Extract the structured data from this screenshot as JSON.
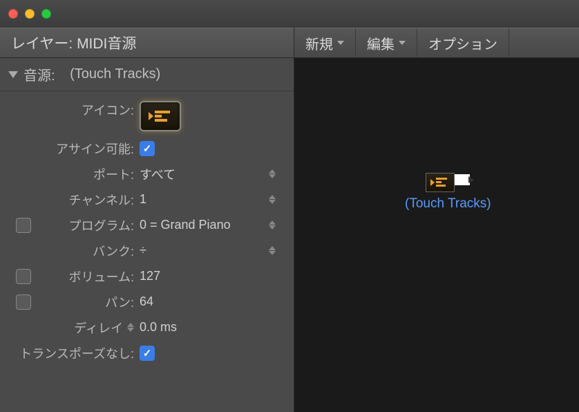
{
  "titlebar": {},
  "sidebar": {
    "layer_label": "レイヤー:",
    "layer_value": "MIDI音源",
    "section_label": "音源:",
    "section_value": "(Touch Tracks)",
    "props": {
      "icon_label": "アイコン:",
      "assignable_label": "アサイン可能:",
      "assignable_checked": true,
      "port_label": "ポート:",
      "port_value": "すべて",
      "channel_label": "チャンネル:",
      "channel_value": "1",
      "program_label": "プログラム:",
      "program_value": "0 = Grand Piano",
      "program_enabled": false,
      "bank_label": "バンク:",
      "bank_value": "÷",
      "volume_label": "ボリューム:",
      "volume_value": "127",
      "volume_enabled": false,
      "pan_label": "パン:",
      "pan_value": "64",
      "pan_enabled": false,
      "delay_label": "ディレイ",
      "delay_value": "0.0 ms",
      "transpose_label": "トランスポーズなし:",
      "transpose_checked": true
    }
  },
  "toolbar": {
    "new_label": "新規",
    "edit_label": "編集",
    "options_label": "オプション"
  },
  "canvas": {
    "object_label": "(Touch Tracks)"
  }
}
